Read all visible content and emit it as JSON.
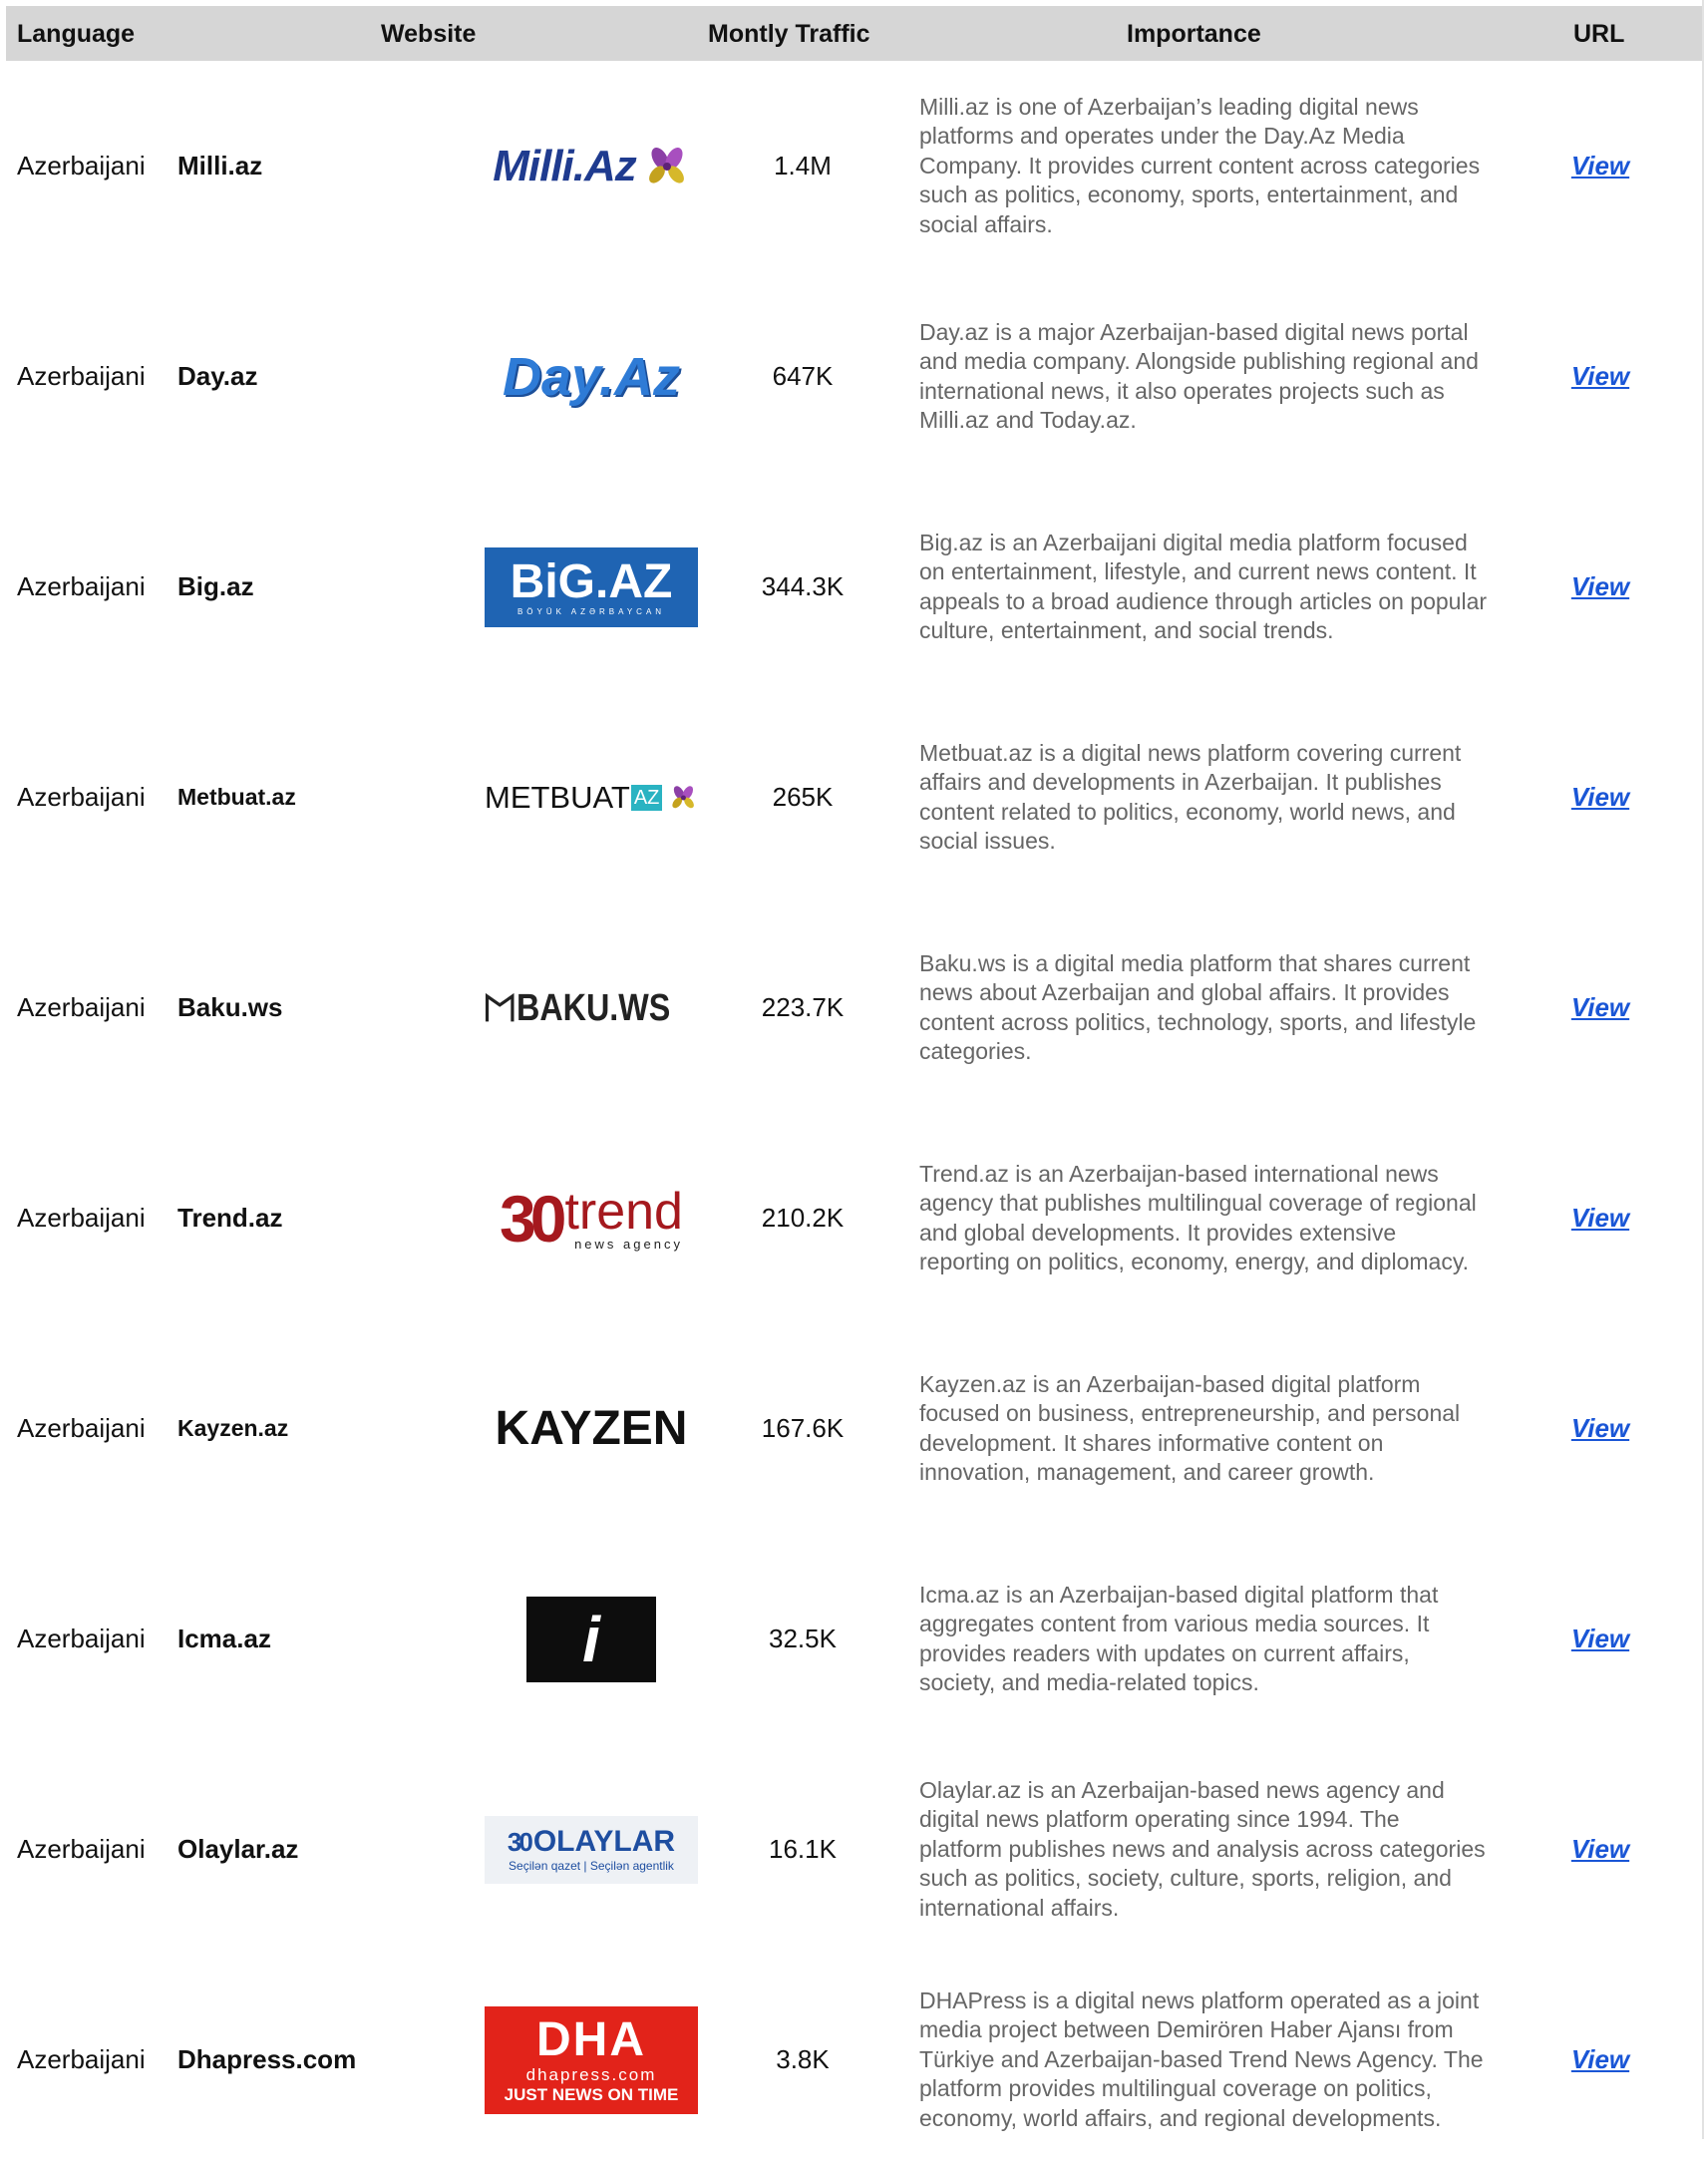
{
  "header": {
    "language": "Language",
    "website": "Website",
    "traffic": "Montly Traffic",
    "importance": "Importance",
    "url": "URL"
  },
  "rows": [
    {
      "language": "Azerbaijani",
      "site": "Milli.az",
      "traffic": "1.4M",
      "logo": "Milli.Az",
      "importance": "Milli.az is one of Azerbaijan’s leading digital news platforms and operates under the Day.Az Media Company. It provides current content across categories such as politics, economy, sports, entertainment, and social affairs.",
      "link": "View"
    },
    {
      "language": "Azerbaijani",
      "site": "Day.az",
      "traffic": "647K",
      "logo": "Day.Az",
      "importance": "Day.az is a major Azerbaijan-based digital news portal and media company. Alongside publishing regional and international news, it also operates projects such as Milli.az and Today.az.",
      "link": "View"
    },
    {
      "language": "Azerbaijani",
      "site": "Big.az",
      "traffic": "344.3K",
      "logo": "BiG.AZ",
      "logo_sub": "BÖYÜK AZƏRBAYCAN",
      "importance": "Big.az is an Azerbaijani digital media platform focused on entertainment, lifestyle, and current news content. It appeals to a broad audience through articles on popular culture, entertainment, and social trends.",
      "link": "View"
    },
    {
      "language": "Azerbaijani",
      "site": "Metbuat.az",
      "traffic": "265K",
      "logo": "METBUAT",
      "logo_badge": "AZ",
      "importance": "Metbuat.az is a digital news platform covering current affairs and developments in Azerbaijan. It publishes content related to politics, economy, world news, and social issues.",
      "link": "View"
    },
    {
      "language": "Azerbaijani",
      "site": "Baku.ws",
      "traffic": "223.7K",
      "logo": "BAKU.WS",
      "importance": "Baku.ws is a digital media platform that shares current news about Azerbaijan and global affairs. It provides content across politics, technology, sports, and lifestyle categories.",
      "link": "View"
    },
    {
      "language": "Azerbaijani",
      "site": "Trend.az",
      "traffic": "210.2K",
      "logo": "trend",
      "logo_num": "30",
      "logo_sub": "news agency",
      "importance": "Trend.az is an Azerbaijan-based international news agency that publishes multilingual coverage of regional and global developments. It provides extensive reporting on politics, economy, energy, and diplomacy.",
      "link": "View"
    },
    {
      "language": "Azerbaijani",
      "site": "Kayzen.az",
      "traffic": "167.6K",
      "logo": "KAYZEN",
      "importance": "Kayzen.az is an Azerbaijan-based digital platform focused on business, entrepreneurship, and personal development. It shares informative content on innovation, management, and career growth.",
      "link": "View"
    },
    {
      "language": "Azerbaijani",
      "site": "Icma.az",
      "traffic": "32.5K",
      "logo": "i",
      "importance": "Icma.az is an Azerbaijan-based digital platform that aggregates content from various media sources. It provides readers with updates on current affairs, society, and media-related topics.",
      "link": "View"
    },
    {
      "language": "Azerbaijani",
      "site": "Olaylar.az",
      "traffic": "16.1K",
      "logo": "OLAYLAR",
      "logo_num": "30",
      "logo_sub": "Seçilən qazet | Seçilən agentlik",
      "importance": "Olaylar.az is an Azerbaijan-based news agency and digital news platform operating since 1994. The platform publishes news and analysis across categories such as politics, society, culture, sports, religion, and international affairs.",
      "link": "View"
    },
    {
      "language": "Azerbaijani",
      "site": "Dhapress.com",
      "traffic": "3.8K",
      "logo": "DHA",
      "logo_url": "dhapress.com",
      "logo_sub": "JUST NEWS ON TIME",
      "importance": "DHAPress is a digital news platform operated as a joint media project between Demirören Haber Ajansı from Türkiye and Azerbaijan-based Trend News Agency. The platform provides multilingual coverage on politics, economy, world affairs, and regional developments.",
      "link": "View"
    }
  ]
}
